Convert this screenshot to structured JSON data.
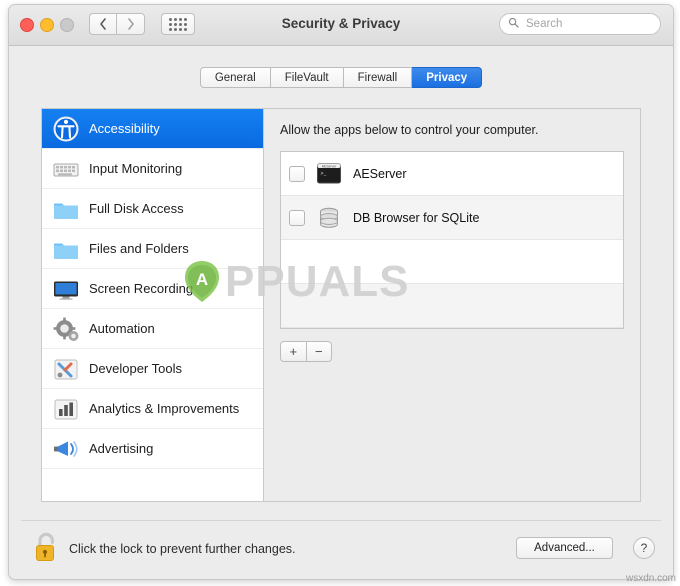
{
  "window": {
    "title": "Security & Privacy",
    "traffic_lights": [
      "close",
      "minimize",
      "zoom"
    ],
    "nav": {
      "back_label": "‹",
      "forward_label": "›",
      "grid_label": "show-all"
    },
    "search": {
      "placeholder": "Search",
      "value": ""
    }
  },
  "tabs": [
    {
      "label": "General",
      "active": false
    },
    {
      "label": "FileVault",
      "active": false
    },
    {
      "label": "Firewall",
      "active": false
    },
    {
      "label": "Privacy",
      "active": true
    }
  ],
  "sidebar": {
    "items": [
      {
        "label": "Accessibility",
        "icon": "accessibility-icon",
        "selected": true
      },
      {
        "label": "Input Monitoring",
        "icon": "keyboard-icon",
        "selected": false
      },
      {
        "label": "Full Disk Access",
        "icon": "folder-icon",
        "selected": false
      },
      {
        "label": "Files and Folders",
        "icon": "folder-icon",
        "selected": false
      },
      {
        "label": "Screen Recording",
        "icon": "display-icon",
        "selected": false
      },
      {
        "label": "Automation",
        "icon": "gear-icon",
        "selected": false
      },
      {
        "label": "Developer Tools",
        "icon": "tools-icon",
        "selected": false
      },
      {
        "label": "Analytics & Improvements",
        "icon": "bar-chart-icon",
        "selected": false
      },
      {
        "label": "Advertising",
        "icon": "megaphone-icon",
        "selected": false
      }
    ]
  },
  "pane": {
    "description": "Allow the apps below to control your computer.",
    "apps": [
      {
        "name": "AEServer",
        "icon": "terminal-icon",
        "checked": false
      },
      {
        "name": "DB Browser for SQLite",
        "icon": "database-icon",
        "checked": false
      }
    ],
    "add_label": "+",
    "remove_label": "−"
  },
  "footer": {
    "lock_icon": "padlock-unlocked-icon",
    "lock_text": "Click the lock to prevent further changes.",
    "advanced_label": "Advanced...",
    "help_label": "?"
  },
  "watermark": {
    "text": "PPUALS",
    "badge": "appuals-logo",
    "corner_url": "wsxdn.com"
  },
  "colors": {
    "accent_blue": "#1a6fe0",
    "window_bg": "#ececec",
    "pane_bg": "#ececec",
    "list_bg": "#ffffff",
    "watermark_gray": "#cfcfcf"
  }
}
